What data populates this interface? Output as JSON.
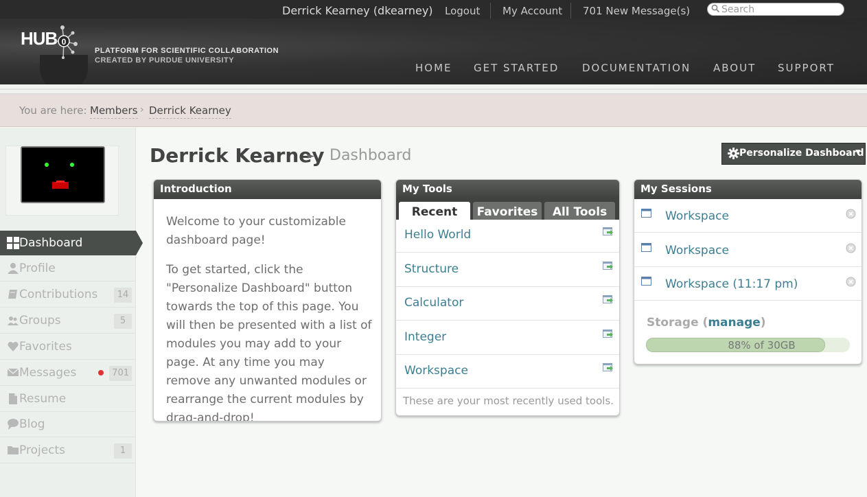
{
  "topbar": {
    "user": "Derrick Kearney (dkearney)",
    "logout": "Logout",
    "my_account": "My Account",
    "messages": "701 New Message(s)",
    "search_placeholder": "Search"
  },
  "header": {
    "logo": "HUB",
    "logo_zero": "0",
    "tagline1": "PLATFORM FOR SCIENTIFIC COLLABORATION",
    "tagline2": "CREATED BY PURDUE UNIVERSITY",
    "nav": [
      "HOME",
      "GET STARTED",
      "DOCUMENTATION",
      "ABOUT",
      "SUPPORT"
    ]
  },
  "breadcrumb": {
    "prefix": "You are here:",
    "items": [
      "Members",
      "Derrick Kearney"
    ],
    "separator": "›"
  },
  "sidebar": {
    "items": [
      {
        "label": "Dashboard",
        "icon": "dashboard-icon",
        "count": null
      },
      {
        "label": "Profile",
        "icon": "user-icon",
        "count": null
      },
      {
        "label": "Contributions",
        "icon": "book-icon",
        "count": "14"
      },
      {
        "label": "Groups",
        "icon": "group-icon",
        "count": "5"
      },
      {
        "label": "Favorites",
        "icon": "heart-icon",
        "count": null
      },
      {
        "label": "Messages",
        "icon": "envelope-icon",
        "count": "701"
      },
      {
        "label": "Resume",
        "icon": "document-icon",
        "count": null
      },
      {
        "label": "Blog",
        "icon": "speech-bubble-icon",
        "count": null
      },
      {
        "label": "Projects",
        "icon": "folder-icon",
        "count": "1"
      }
    ]
  },
  "main": {
    "title": "Derrick Kearney",
    "arrow": "►",
    "subtitle": "Dashboard",
    "personalize_label": "Personalize Dashboard",
    "caret": "▼"
  },
  "intro": {
    "title": "Introduction",
    "p1": "Welcome to your customizable dashboard page!",
    "p2": "To get started, click the \"Personalize Dashboard\" button towards the top of this page. You will then be presented with a list of modules you may add to your page. At any time you may remove any unwanted modules or rearrange the current modules by drag-and-drop!"
  },
  "tools": {
    "title": "My Tools",
    "tabs": [
      "Recent",
      "Favorites",
      "All Tools"
    ],
    "items": [
      "Hello World",
      "Structure",
      "Calculator",
      "Integer",
      "Workspace"
    ],
    "footer": "These are your most recently used tools."
  },
  "sessions": {
    "title": "My Sessions",
    "items": [
      "Workspace",
      "Workspace",
      "Workspace (11:17 pm)"
    ],
    "storage_label": "Storage",
    "storage_open": "(",
    "storage_manage": "manage",
    "storage_close": ")",
    "storage_text": "88% of 30GB",
    "storage_fraction": 0.88
  },
  "colors": {
    "accent_link": "#3c7e91",
    "header_dark": "#2b2b2b",
    "breadcrumb_bg": "#e8dfdc",
    "storage_fill": "#bdd6b0",
    "notification_dot": "#dd3333"
  }
}
